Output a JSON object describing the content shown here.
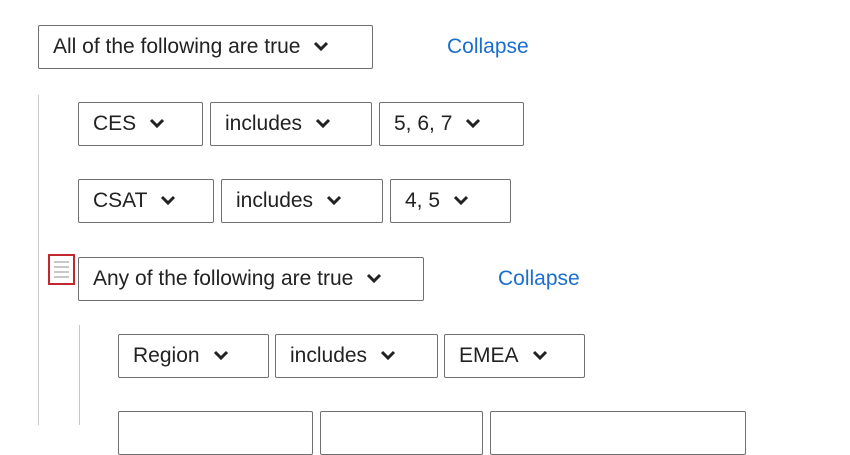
{
  "groups": {
    "outer": {
      "operator": "All of the following are true",
      "collapse": "Collapse"
    },
    "inner": {
      "operator": "Any of the following are true",
      "collapse": "Collapse"
    }
  },
  "conditions": [
    {
      "field": "CES",
      "op": "includes",
      "value": "5, 6, 7"
    },
    {
      "field": "CSAT",
      "op": "includes",
      "value": "4, 5"
    },
    {
      "field": "Region",
      "op": "includes",
      "value": "EMEA"
    }
  ],
  "icons": {
    "dropdown": "chevron-down-icon",
    "drag": "drag-handle-icon"
  },
  "colors": {
    "link": "#1a6ecf",
    "handle_highlight": "#c0282e",
    "border": "#6f6f6f"
  }
}
